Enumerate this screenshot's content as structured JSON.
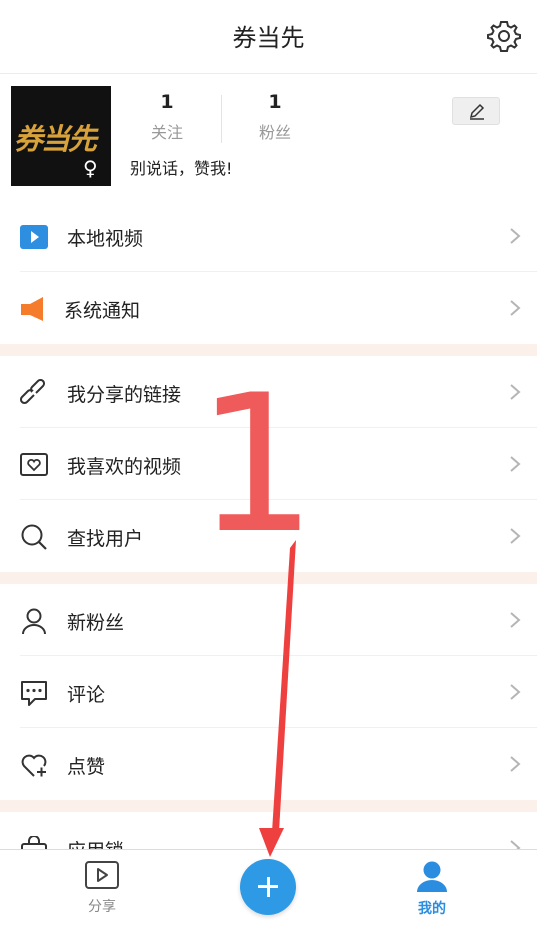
{
  "header": {
    "title": "券当先"
  },
  "profile": {
    "avatar_text": "券当先",
    "gender_symbol": "♀",
    "following": {
      "count": "1",
      "label": "关注"
    },
    "fans": {
      "count": "1",
      "label": "粉丝"
    },
    "bio": "别说话，赞我!"
  },
  "menu": {
    "local_video": "本地视频",
    "system_notice": "系统通知",
    "my_shared_links": "我分享的链接",
    "my_liked_videos": "我喜欢的视频",
    "find_users": "查找用户",
    "new_fans": "新粉丝",
    "comments": "评论",
    "likes": "点赞",
    "app_store": "应用锁"
  },
  "tabbar": {
    "share_label": "分享",
    "mine_label": "我的"
  },
  "annotation": {
    "number": "1"
  },
  "colors": {
    "accent_blue": "#2e9ae6",
    "annotation_red": "#ef4040",
    "orange": "#f57c2b",
    "section_gap": "#fbf1ea"
  }
}
